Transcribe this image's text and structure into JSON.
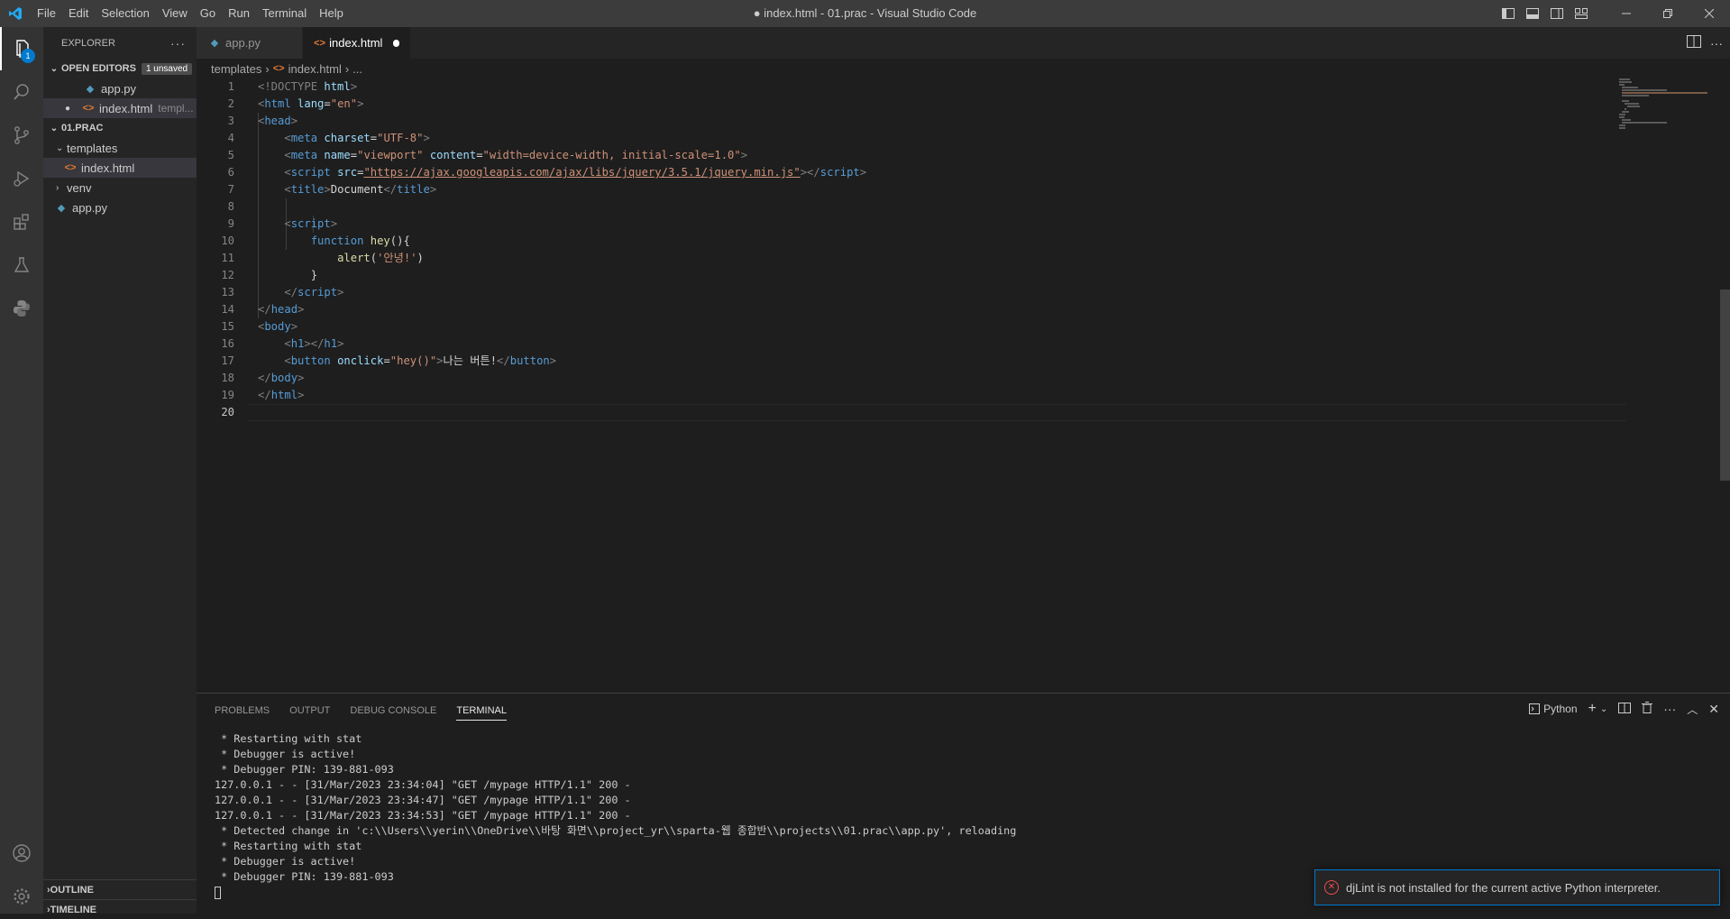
{
  "titlebar": {
    "menu": [
      "File",
      "Edit",
      "Selection",
      "View",
      "Go",
      "Run",
      "Terminal",
      "Help"
    ],
    "title": "● index.html - 01.prac - Visual Studio Code"
  },
  "activity": {
    "explorer_badge": "1"
  },
  "sidebar": {
    "header": "EXPLORER",
    "more": "···",
    "open_editors": "OPEN EDITORS",
    "unsaved_badge": "1 unsaved",
    "open_files": [
      {
        "name": "app.py",
        "path": ""
      },
      {
        "name": "index.html",
        "path": "templ..."
      }
    ],
    "project": "01.PRAC",
    "tree": {
      "templates": "templates",
      "index": "index.html",
      "venv": "venv",
      "app": "app.py"
    },
    "outline": "OUTLINE",
    "timeline": "TIMELINE"
  },
  "tabs": [
    {
      "label": "app.py"
    },
    {
      "label": "index.html"
    }
  ],
  "breadcrumb": {
    "folder": "templates",
    "file": "index.html",
    "more": "..."
  },
  "editor": {
    "line_numbers": [
      "1",
      "2",
      "3",
      "4",
      "5",
      "6",
      "7",
      "8",
      "9",
      "10",
      "11",
      "12",
      "13",
      "14",
      "15",
      "16",
      "17",
      "18",
      "19",
      "20"
    ],
    "code": {
      "l1a": "<!DOCTYPE",
      "l1b": " html",
      "l1c": ">",
      "l2_lang": "\"en\"",
      "l4_charset": "\"UTF-8\"",
      "l5_name": "\"viewport\"",
      "l5_content": "\"width=device-width, initial-scale=1.0\"",
      "l6_src": "\"https://ajax.googleapis.com/ajax/libs/jquery/3.5.1/jquery.min.js\"",
      "l7_text": "Document",
      "l10_kw": "function",
      "l10_fn": "hey",
      "l10_rest": "(){",
      "l11_fn": "alert",
      "l11_str": "'안녕!'",
      "l12": "}",
      "l17_attr": "\"hey()\"",
      "l17_text": "나는 버튼!"
    }
  },
  "panel": {
    "tabs": [
      "PROBLEMS",
      "OUTPUT",
      "DEBUG CONSOLE",
      "TERMINAL"
    ],
    "terminal_profile": "Python",
    "terminal_lines": [
      " * Restarting with stat",
      " * Debugger is active!",
      " * Debugger PIN: 139-881-093",
      "127.0.0.1 - - [31/Mar/2023 23:34:04] \"GET /mypage HTTP/1.1\" 200 -",
      "127.0.0.1 - - [31/Mar/2023 23:34:47] \"GET /mypage HTTP/1.1\" 200 -",
      "127.0.0.1 - - [31/Mar/2023 23:34:53] \"GET /mypage HTTP/1.1\" 200 -",
      " * Detected change in 'c:\\\\Users\\\\yerin\\\\OneDrive\\\\바탕 화면\\\\project_yr\\\\sparta-웹 종합반\\\\projects\\\\01.prac\\\\app.py', reloading",
      " * Restarting with stat",
      " * Debugger is active!",
      " * Debugger PIN: 139-881-093"
    ]
  },
  "notification": {
    "message": "djLint is not installed for the current active Python interpreter."
  }
}
